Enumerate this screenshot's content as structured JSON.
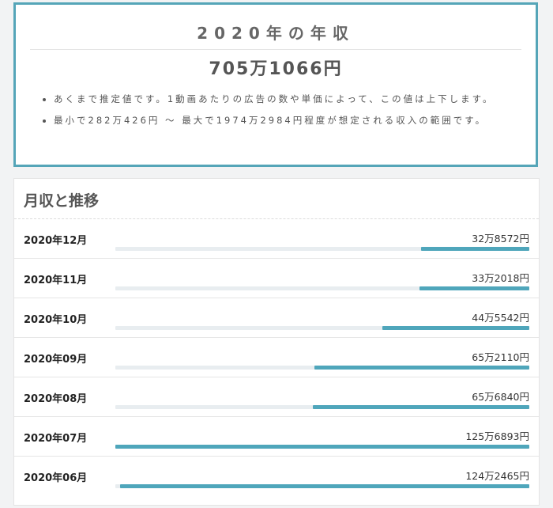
{
  "annual": {
    "title": "2020年の年収",
    "amount": "705万1066円",
    "notes": [
      "あくまで推定値です。1動画あたりの広告の数や単価によって、この値は上下します。",
      "最小で282万426円 〜 最大で1974万2984円程度が想定される収入の範囲です。"
    ]
  },
  "monthly": {
    "title": "月収と推移",
    "rows": [
      {
        "month": "2020年12月",
        "value": "32万8572円",
        "fill": 0.262
      },
      {
        "month": "2020年11月",
        "value": "33万2018円",
        "fill": 0.265
      },
      {
        "month": "2020年10月",
        "value": "44万5542円",
        "fill": 0.355
      },
      {
        "month": "2020年09月",
        "value": "65万2110円",
        "fill": 0.519
      },
      {
        "month": "2020年08月",
        "value": "65万6840円",
        "fill": 0.523
      },
      {
        "month": "2020年07月",
        "value": "125万6893円",
        "fill": 1.0
      },
      {
        "month": "2020年06月",
        "value": "124万2465円",
        "fill": 0.988
      }
    ]
  },
  "colors": {
    "accent": "#4fa6bb",
    "border": "#55a5b8",
    "track": "#e8edf0"
  }
}
